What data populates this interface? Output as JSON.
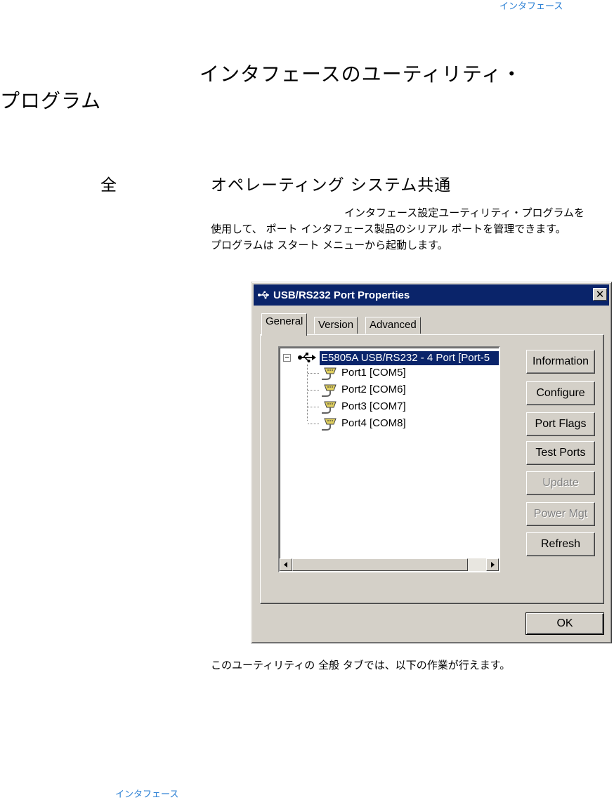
{
  "header": {
    "section_link": "インタフェース"
  },
  "title": {
    "line1": "インタフェースのユーティリティ・",
    "line2": "プログラム"
  },
  "section": {
    "number": "全",
    "title": "オペレーティング システム共通"
  },
  "body": {
    "line1": "インタフェース設定ユーティリティ・プログラムを",
    "line2": "使用して、 ポート インタフェース製品のシリアル ポートを管理できます。",
    "line3": "プログラムは スタート メニューから起動します。"
  },
  "dialog": {
    "title": "USB/RS232 Port Properties",
    "close_glyph": "✕",
    "tabs": [
      {
        "label": "General",
        "active": true
      },
      {
        "label": "Version",
        "active": false
      },
      {
        "label": "Advanced",
        "active": false
      }
    ],
    "tree": {
      "expander": "−",
      "root": "E5805A USB/RS232 - 4 Port [Port-5",
      "ports": [
        "Port1 [COM5]",
        "Port2 [COM6]",
        "Port3 [COM7]",
        "Port4 [COM8]"
      ]
    },
    "buttons": [
      {
        "label": "Information",
        "enabled": true
      },
      {
        "label": "Configure",
        "enabled": true
      },
      {
        "label": "Port Flags",
        "enabled": true
      },
      {
        "label": "Test Ports",
        "enabled": true
      },
      {
        "label": "Update",
        "enabled": false
      },
      {
        "label": "Power Mgt",
        "enabled": false
      },
      {
        "label": "Refresh",
        "enabled": true
      }
    ],
    "ok_label": "OK",
    "selected_color": "#0a246a"
  },
  "caption": "このユーティリティの 全般 タブでは、以下の作業が行えます。",
  "footer": {
    "section_link": "インタフェース"
  }
}
